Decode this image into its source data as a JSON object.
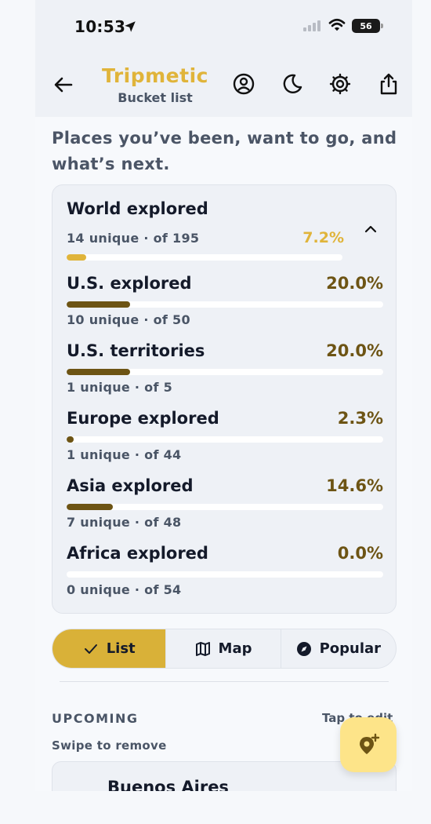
{
  "status": {
    "time": "10:53",
    "battery": "56"
  },
  "header": {
    "title": "Tripmetic",
    "subtitle": "Bucket list"
  },
  "intro": "Places you’ve been, want to go, and what’s next.",
  "colors": {
    "accent": "#e0b43a",
    "bar_dark": "#6d5414",
    "bar_light": "#e0b43a",
    "active_segment": "#d9b138",
    "fab": "#fde489"
  },
  "world": {
    "title": "World explored",
    "sub": "14 unique · of 195",
    "pct": "7.2%",
    "fraction": 0.072
  },
  "regions": [
    {
      "title": "U.S. explored",
      "pct": "20.0%",
      "sub": "10 unique · of 50",
      "fraction": 0.2
    },
    {
      "title": "U.S. territories",
      "pct": "20.0%",
      "sub": "1 unique · of 5",
      "fraction": 0.2
    },
    {
      "title": "Europe explored",
      "pct": "2.3%",
      "sub": "1 unique · of 44",
      "fraction": 0.023
    },
    {
      "title": "Asia explored",
      "pct": "14.6%",
      "sub": "7 unique · of 48",
      "fraction": 0.146
    },
    {
      "title": "Africa explored",
      "pct": "0.0%",
      "sub": "0 unique · of 54",
      "fraction": 0.0
    }
  ],
  "view_tabs": [
    {
      "label": "List",
      "icon": "check-icon",
      "active": true
    },
    {
      "label": "Map",
      "icon": "map-icon",
      "active": false
    },
    {
      "label": "Popular",
      "icon": "compass-icon",
      "active": false
    }
  ],
  "upcoming": {
    "heading": "UPCOMING",
    "hint": "Tap to edit",
    "swipe": "Swipe to remove",
    "first_trip": "Buenos Aires"
  }
}
